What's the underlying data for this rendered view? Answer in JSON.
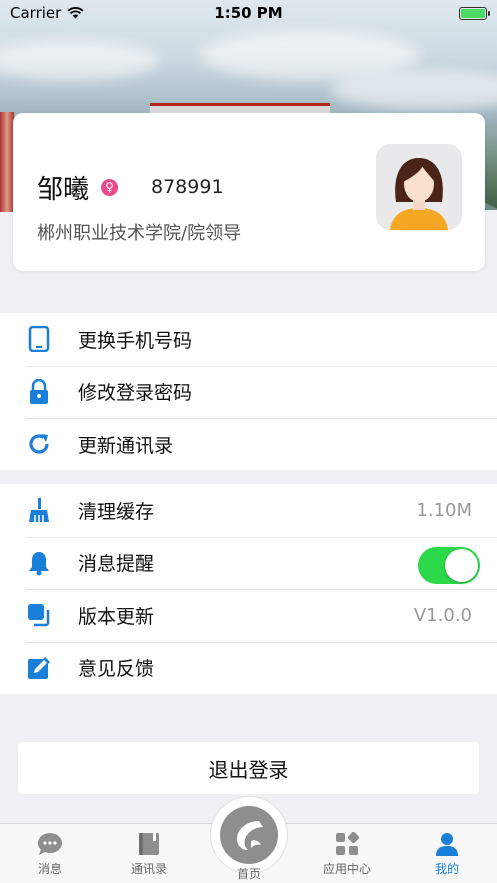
{
  "status_bar": {
    "carrier": "Carrier",
    "time": "1:50 PM"
  },
  "profile": {
    "name": "邹曦",
    "gender_symbol": "♀",
    "id": "878991",
    "organization": "郴州职业技术学院/院领导"
  },
  "menu_group_1": [
    {
      "label": "更换手机号码",
      "icon": "phone-icon"
    },
    {
      "label": "修改登录密码",
      "icon": "lock-icon"
    },
    {
      "label": "更新通讯录",
      "icon": "refresh-icon"
    }
  ],
  "menu_group_2": [
    {
      "label": "清理缓存",
      "icon": "broom-icon",
      "value": "1.10M"
    },
    {
      "label": "消息提醒",
      "icon": "bell-icon",
      "toggle_on": true
    },
    {
      "label": "版本更新",
      "icon": "version-icon",
      "value": "V1.0.0"
    },
    {
      "label": "意见反馈",
      "icon": "edit-icon"
    }
  ],
  "logout_label": "退出登录",
  "tabs": [
    {
      "label": "消息",
      "icon": "chat-icon",
      "active": false
    },
    {
      "label": "通讯录",
      "icon": "contacts-icon",
      "active": false
    },
    {
      "label": "首页",
      "icon": "home-logo-icon",
      "active": false
    },
    {
      "label": "应用中心",
      "icon": "apps-icon",
      "active": false
    },
    {
      "label": "我的",
      "icon": "person-icon",
      "active": true
    }
  ],
  "colors": {
    "accent": "#1a7fd8",
    "toggle_on": "#2bd94a",
    "gender": "#e84a8a"
  }
}
